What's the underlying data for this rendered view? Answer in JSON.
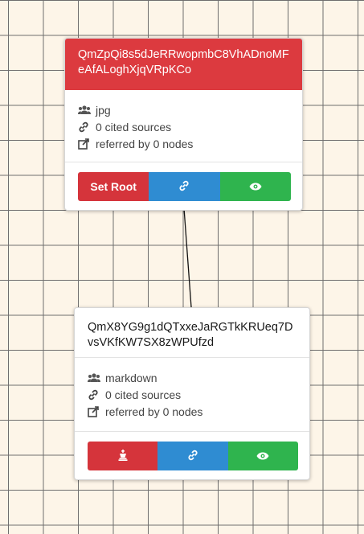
{
  "nodes": [
    {
      "hash": "QmZpQi8s5dJeRRwopmbC8VhADnoMFeAfALoghXjqVRpKCo",
      "type": "jpg",
      "cited": "0 cited sources",
      "referred": "referred by 0 nodes",
      "actions": {
        "root_label": "Set Root",
        "link_icon": "link-icon",
        "view_icon": "eye-icon"
      },
      "selected": true
    },
    {
      "hash": "QmX8YG9g1dQTxxeJaRGTkKRUeq7DvsVKfKW7SX8zWPUfzd",
      "type": "markdown",
      "cited": "0 cited sources",
      "referred": "referred by 0 nodes",
      "actions": {
        "root_icon": "chess-king-icon",
        "link_icon": "link-icon",
        "view_icon": "eye-icon"
      },
      "selected": false
    }
  ],
  "colors": {
    "background": "#fdf5e8",
    "grid": "#6e6e6e",
    "selected_header": "#dc3a3f",
    "red": "#d5343b",
    "blue": "#2f8cd2",
    "green": "#2fb44e"
  }
}
